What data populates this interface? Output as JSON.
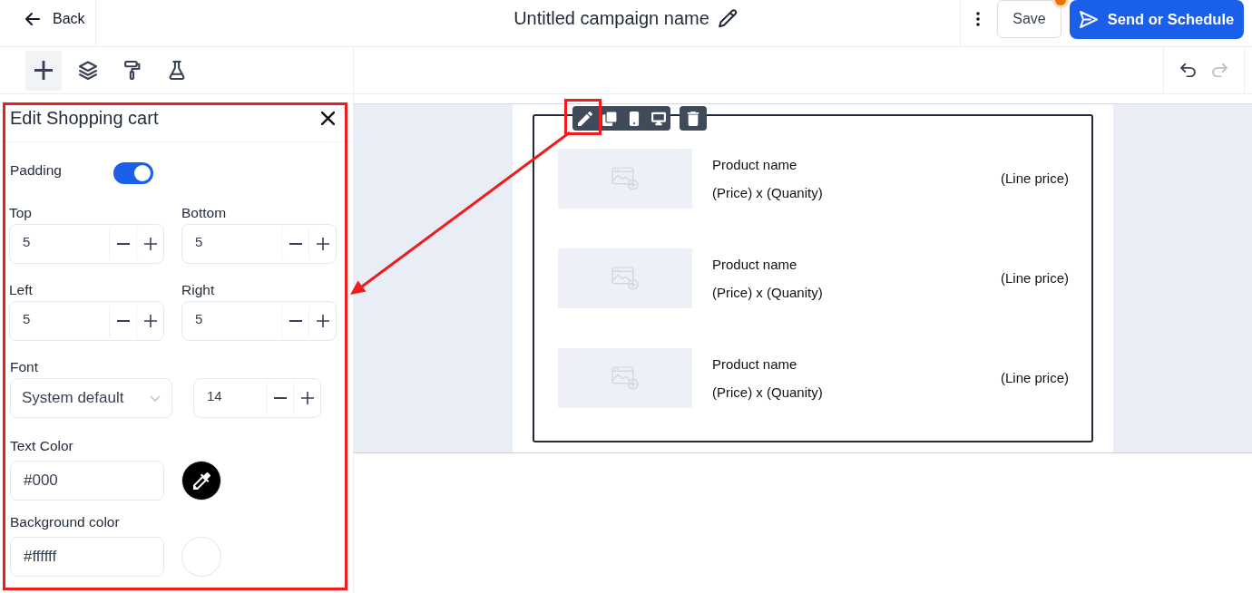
{
  "header": {
    "back_label": "Back",
    "title": "Untitled campaign name",
    "save_label": "Save",
    "save_notification": true,
    "send_label": "Send or Schedule"
  },
  "tools": [
    {
      "kind": "add",
      "selected": true
    },
    {
      "kind": "layers",
      "selected": false
    },
    {
      "kind": "style",
      "selected": false
    },
    {
      "kind": "test",
      "selected": false
    }
  ],
  "history": [
    {
      "kind": "undo",
      "disabled": false
    },
    {
      "kind": "redo",
      "disabled": true
    }
  ],
  "panel": {
    "title": "Edit Shopping cart",
    "highlighted": true,
    "padding": {
      "label": "Padding",
      "on": true
    },
    "padding_fields": [
      {
        "label": "Top",
        "value": "5"
      },
      {
        "label": "Bottom",
        "value": "5"
      },
      {
        "label": "Left",
        "value": "5"
      },
      {
        "label": "Right",
        "value": "5"
      }
    ],
    "font": {
      "label": "Font",
      "family": "System default",
      "size": "14"
    },
    "colors": [
      {
        "label": "Text Color",
        "value": "#000",
        "color": "#000000",
        "eyedropper": true
      },
      {
        "label": "Background color",
        "value": "#ffffff",
        "color": "#ffffff",
        "eyedropper": false
      }
    ]
  },
  "block_toolbar": [
    {
      "kind": "edit",
      "highlighted": true
    },
    {
      "kind": "copy",
      "highlighted": false
    },
    {
      "kind": "mobile",
      "highlighted": false
    },
    {
      "kind": "desktop",
      "highlighted": false
    },
    {
      "kind": "delete",
      "highlighted": false
    }
  ],
  "cart_items": [
    {
      "name": "Product name",
      "quantity_line": "(Price) x (Quanity)",
      "line_price": "(Line price)"
    },
    {
      "name": "Product name",
      "quantity_line": "(Price) x (Quanity)",
      "line_price": "(Line price)"
    },
    {
      "name": "Product name",
      "quantity_line": "(Price) x (Quanity)",
      "line_price": "(Line price)"
    }
  ]
}
